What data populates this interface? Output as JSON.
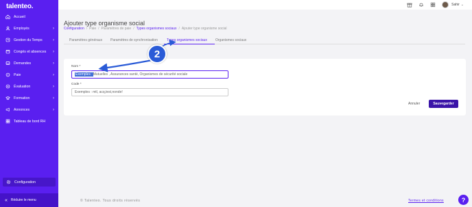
{
  "app": {
    "logo": "talenteo."
  },
  "sidebar": {
    "items": [
      {
        "label": "Accueil",
        "icon": "home-icon",
        "chevron": ""
      },
      {
        "label": "Employés",
        "icon": "users-icon",
        "chevron": "›"
      },
      {
        "label": "Gestion du Temps",
        "icon": "clock-icon",
        "chevron": "›"
      },
      {
        "label": "Congés et absences",
        "icon": "calendar-icon",
        "chevron": "›"
      },
      {
        "label": "Demandes",
        "icon": "inbox-icon",
        "chevron": "›"
      },
      {
        "label": "Paie",
        "icon": "money-icon",
        "chevron": "›"
      },
      {
        "label": "Évaluation",
        "icon": "evaluation-icon",
        "chevron": "›"
      },
      {
        "label": "Formation",
        "icon": "formation-icon",
        "chevron": "›"
      },
      {
        "label": "Annonces",
        "icon": "megaphone-icon",
        "chevron": "›"
      },
      {
        "label": "Tableau de bord RH",
        "icon": "dashboard-icon",
        "chevron": ""
      }
    ],
    "config_label": "Configuration",
    "reduce_label": "Réduire le menu"
  },
  "topbar": {
    "user_name": "Sahir",
    "user_chevron": "⌄"
  },
  "page": {
    "title": "Ajouter type organisme social",
    "breadcrumb": [
      "Configuration",
      "Paie",
      "Paramètres de paie",
      "Types organismes sociaux",
      "Ajouter type organisme social"
    ],
    "breadcrumb_sep": "/"
  },
  "tabs": [
    "Paramètres généraux",
    "Paramètres de synchronisation",
    "Types organismes sociaux",
    "Organismes sociaux"
  ],
  "form": {
    "nom_label": "Nom *",
    "nom_highlight": "Exemples :",
    "nom_rest": " Mutuelles , Assurances santé, Organismes de sécurité sociale",
    "code_label": "Code *",
    "code_placeholder": "Exemples : mtl, acq,test,nonde!",
    "cancel_label": "Annuler",
    "save_label": "Sauvegarder"
  },
  "annotation": {
    "step": "2"
  },
  "footer": {
    "copyright": "© Talenteo. Tous droits réservés",
    "terms": "Termes et conditions",
    "help": "?"
  },
  "colors": {
    "primary": "#5a1ff0",
    "save_button": "#3a14a8",
    "annotation": "#2a5bd7"
  }
}
